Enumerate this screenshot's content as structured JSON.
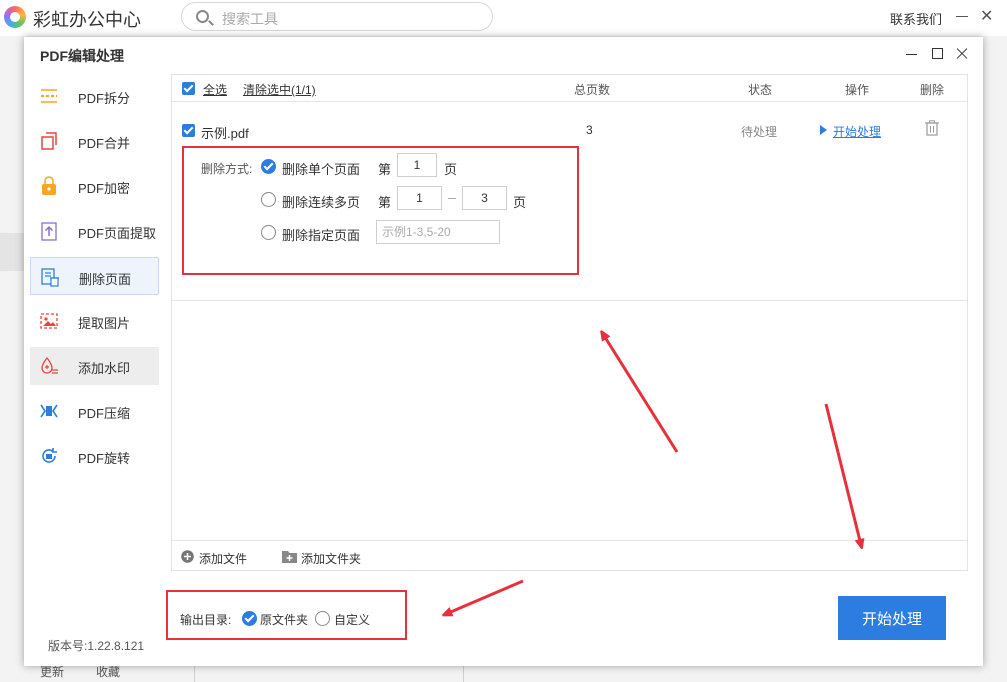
{
  "app": {
    "title": "彩虹办公中心",
    "search_placeholder": "搜索工具",
    "contact": "联系我们",
    "footer_left": "更新",
    "footer_right": "收藏"
  },
  "dialog": {
    "title": "PDF编辑处理",
    "version": "版本号:1.22.8.121"
  },
  "sidebar": {
    "items": [
      {
        "label": "PDF拆分",
        "icon": "split-icon",
        "color": "#f5a623"
      },
      {
        "label": "PDF合并",
        "icon": "merge-icon",
        "color": "#e8453c"
      },
      {
        "label": "PDF加密",
        "icon": "lock-icon",
        "color": "#f5a623"
      },
      {
        "label": "PDF页面提取",
        "icon": "extract-page-icon",
        "color": "#8e6bd8"
      },
      {
        "label": "删除页面",
        "icon": "delete-page-icon",
        "color": "#2d7ce0"
      },
      {
        "label": "提取图片",
        "icon": "image-icon",
        "color": "#e8453c"
      },
      {
        "label": "添加水印",
        "icon": "watermark-icon",
        "color": "#e8453c"
      },
      {
        "label": "PDF压缩",
        "icon": "compress-icon",
        "color": "#2d7ce0"
      },
      {
        "label": "PDF旋转",
        "icon": "rotate-icon",
        "color": "#2d7ce0"
      }
    ],
    "active_index": 4
  },
  "table": {
    "select_all": "全选",
    "clear_selected": "清除选中(1/1)",
    "columns": {
      "pages": "总页数",
      "status": "状态",
      "action": "操作",
      "delete": "删除"
    },
    "rows": [
      {
        "name": "示例.pdf",
        "pages": "3",
        "status": "待处理",
        "action": "开始处理"
      }
    ]
  },
  "delete_options": {
    "label": "删除方式:",
    "single": {
      "label": "删除单个页面",
      "prefix": "第",
      "value": "1",
      "suffix": "页"
    },
    "range": {
      "label": "删除连续多页",
      "prefix": "第",
      "from": "1",
      "to": "3",
      "suffix": "页"
    },
    "specified": {
      "label": "删除指定页面",
      "placeholder": "示例1-3,5-20"
    }
  },
  "bottom": {
    "add_file": "添加文件",
    "add_folder": "添加文件夹"
  },
  "output": {
    "label": "输出目录:",
    "original": "原文件夹",
    "custom": "自定义"
  },
  "start_button": "开始处理",
  "colors": {
    "accent": "#2d7ce0",
    "annotation": "#e8303c"
  }
}
